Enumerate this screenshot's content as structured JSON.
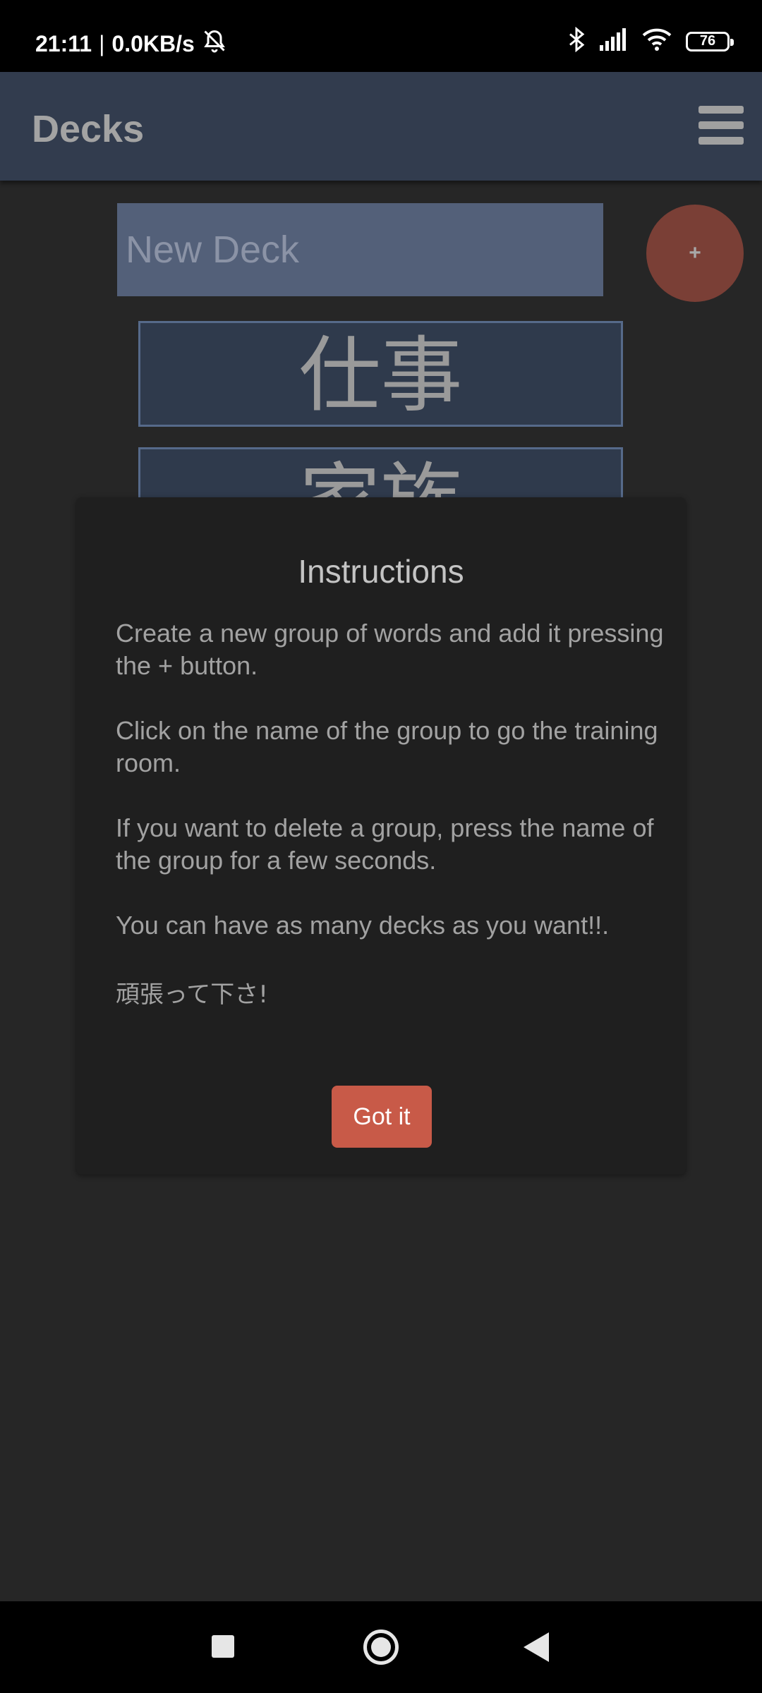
{
  "status_bar": {
    "time": "21:11",
    "separator": "|",
    "network_speed": "0.0KB/s",
    "battery_level": "76",
    "icons": [
      "alarm-off-icon",
      "bluetooth-icon",
      "signal-icon",
      "wifi-icon",
      "battery-icon"
    ]
  },
  "app_bar": {
    "title": "Decks",
    "menu_icon": "hamburger-menu-icon"
  },
  "new_deck": {
    "placeholder": "New Deck",
    "add_label": "+"
  },
  "decks": [
    {
      "name": "仕事"
    },
    {
      "name": "家族"
    }
  ],
  "dialog": {
    "title": "Instructions",
    "paragraphs": [
      "Create a new group of words and add it pressing the + button.",
      "Click on the name of the group to go the training room.",
      "If you want to delete a group, press the name of the group for a few seconds.",
      "You can have as many decks as you want!!.",
      "頑張って下さ!"
    ],
    "button_label": "Got it"
  },
  "colors": {
    "app_bar": "#323c4e",
    "input_bg": "#536079",
    "fab": "#7a3f36",
    "deck_bg": "#2f3a4c",
    "dialog_bg": "#1f1f1f",
    "dialog_button": "#c85a48",
    "background": "#262626"
  }
}
